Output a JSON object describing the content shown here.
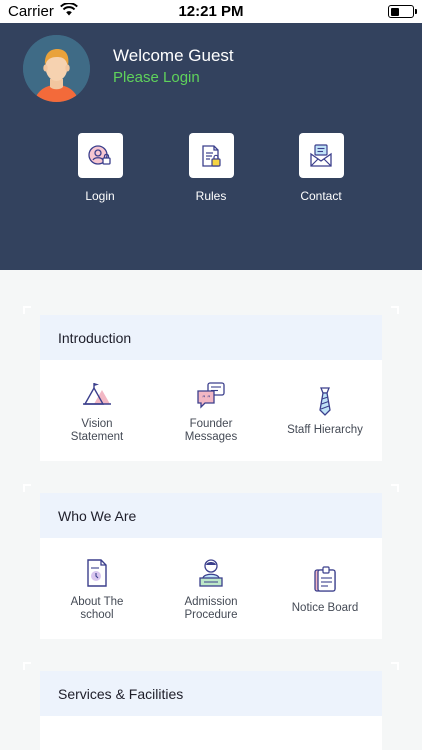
{
  "status_bar": {
    "carrier": "Carrier",
    "time": "12:21 PM"
  },
  "header": {
    "welcome": "Welcome Guest",
    "login_prompt": "Please Login",
    "actions": [
      {
        "label": "Login",
        "icon": "login-icon"
      },
      {
        "label": "Rules",
        "icon": "rules-icon"
      },
      {
        "label": "Contact",
        "icon": "contact-icon"
      }
    ]
  },
  "sections": [
    {
      "title": "Introduction",
      "items": [
        {
          "label": "Vision\nStatement",
          "icon": "vision-icon"
        },
        {
          "label": "Founder\nMessages",
          "icon": "messages-icon"
        },
        {
          "label": "Staff Hierarchy",
          "icon": "tie-icon"
        }
      ]
    },
    {
      "title": "Who We Are",
      "items": [
        {
          "label": "About The\nschool",
          "icon": "document-icon"
        },
        {
          "label": "Admission\nProcedure",
          "icon": "admission-icon"
        },
        {
          "label": "Notice Board",
          "icon": "notice-board-icon"
        }
      ]
    },
    {
      "title": "Services & Facilities",
      "items": []
    }
  ],
  "colors": {
    "header_bg": "#33425e",
    "login_prompt": "#5fd25b",
    "card_head_bg": "#edf3fc",
    "icon_accent": "#3b3f8c",
    "icon_pink": "#f2b7c4"
  }
}
